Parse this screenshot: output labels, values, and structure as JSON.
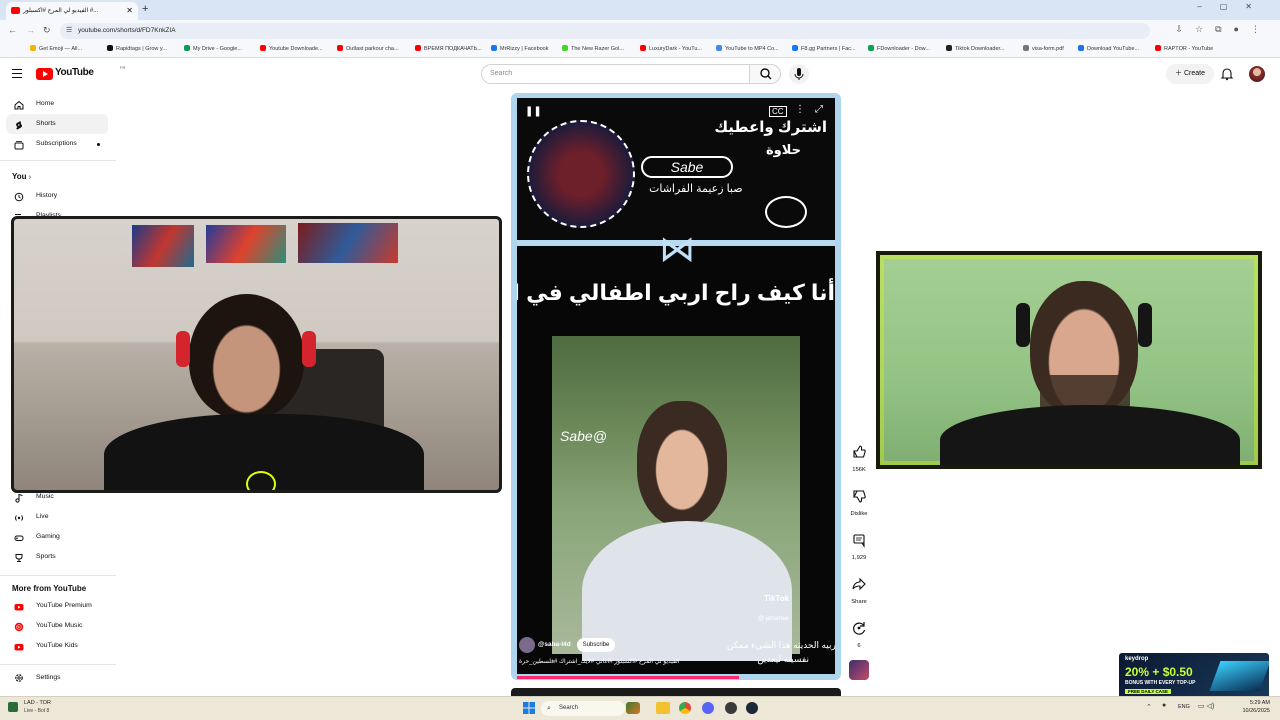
{
  "browser": {
    "tab_title": "الفيديو لي المرح #اكسبلور #...",
    "url": "youtube.com/shorts/d/FD7KnkZIA",
    "bookmarks": [
      {
        "label": "Get Emoji — All...",
        "color": "#f4b400"
      },
      {
        "label": "Rapidtags | Grow y...",
        "color": "#111111"
      },
      {
        "label": "My Drive - Google...",
        "color": "#0f9d58"
      },
      {
        "label": "Youtube Downloade...",
        "color": "#ff0000"
      },
      {
        "label": "Outlast parkour cha...",
        "color": "#ff0000"
      },
      {
        "label": "ВРЕМЯ ПОДКАЧАТЬ...",
        "color": "#ff0000"
      },
      {
        "label": "MrRizzy | Facebook",
        "color": "#1877f2"
      },
      {
        "label": "The New Razer Gol...",
        "color": "#44d62c"
      },
      {
        "label": "LuxuryDark - YouTu...",
        "color": "#ff0000"
      },
      {
        "label": "YouTube to MP4 Co...",
        "color": "#4285f4"
      },
      {
        "label": "F8.gg Partners | Fac...",
        "color": "#1877f2"
      },
      {
        "label": "FDownloader - Dow...",
        "color": "#0aa34f"
      },
      {
        "label": "Tiktok Downloader...",
        "color": "#222222"
      },
      {
        "label": "visa-form.pdf",
        "color": "#777777"
      },
      {
        "label": "Download YouTube...",
        "color": "#1a73e8"
      },
      {
        "label": "RAPTOR - YouTube",
        "color": "#ff0000"
      }
    ]
  },
  "header": {
    "logo_text": "YouTube",
    "logo_country": "FR",
    "search_placeholder": "Search",
    "create_label": "Create"
  },
  "sidebar": {
    "main": [
      {
        "label": "Home",
        "icon": "home-icon"
      },
      {
        "label": "Shorts",
        "icon": "shorts-icon",
        "active": true
      },
      {
        "label": "Subscriptions",
        "icon": "subscriptions-icon"
      }
    ],
    "you_heading": "You",
    "you_items": [
      {
        "label": "History",
        "icon": "history-icon"
      },
      {
        "label": "Playlists",
        "icon": "playlists-icon"
      }
    ],
    "explore_items": [
      {
        "label": "Music",
        "icon": "music-icon"
      },
      {
        "label": "Live",
        "icon": "live-icon"
      },
      {
        "label": "Gaming",
        "icon": "gaming-icon"
      },
      {
        "label": "Sports",
        "icon": "sports-icon"
      }
    ],
    "more_heading": "More from YouTube",
    "more_items": [
      {
        "label": "YouTube Premium",
        "icon": "youtube-premium-icon"
      },
      {
        "label": "YouTube Music",
        "icon": "youtube-music-icon"
      },
      {
        "label": "YouTube Kids",
        "icon": "youtube-kids-icon"
      }
    ],
    "settings_label": "Settings"
  },
  "short": {
    "banner_line1": "اشترك واعطيك",
    "banner_line2": "حلاوة",
    "banner_name": "Sabe",
    "banner_tag": "صبا زعيمة الفراشات",
    "caption": "أنا كيف راح اربي اطفالي في المستقبل",
    "watermark": "Sabe@",
    "tiktok_label": "TikTok",
    "tiktok_user": "@ janamee",
    "channel_handle": "@saba-l4d",
    "subscribe_label": "Subscribe",
    "overlay_text1": "تربيه الحديثه هذا الشيء ممكن",
    "overlay_text2": "نفسيته ليعدين",
    "title": "الفيديو لي المرح #اكسبلور #اغاني #لايك_اشتراك #فلسطين_حرة"
  },
  "actions": {
    "likes": "156K",
    "dislike_label": "Dislike",
    "comments": "1,929",
    "share_label": "Share",
    "remix_count": "6"
  },
  "keydrop": {
    "brand": "keydrop",
    "promo": "20% + $0.50",
    "sub": "BONUS WITH EVERY TOP-UP",
    "code": "FREE DAILY CASE"
  },
  "taskbar": {
    "game_line1": "LAD - TOR",
    "game_line2": "Live - Bot 8",
    "search_label": "Search",
    "lang": "ENG",
    "time": "5:29 AM",
    "date": "10/26/2025"
  },
  "colors": {
    "accent": "#ff0000",
    "player_frame": "#aed4ee",
    "sidebar_active": "#f2f2f2"
  }
}
